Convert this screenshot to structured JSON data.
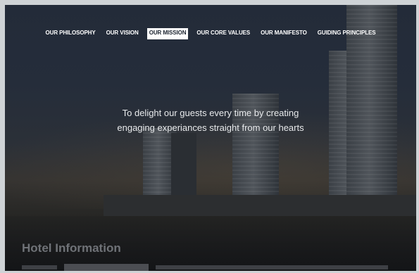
{
  "nav": {
    "items": [
      {
        "label": "OUR PHILOSOPHY"
      },
      {
        "label": "OUR VISION"
      },
      {
        "label": "OUR MISSION"
      },
      {
        "label": "OUR CORE VALUES"
      },
      {
        "label": "OUR MANIFESTO"
      },
      {
        "label": "GUIDING PRINCIPLES"
      }
    ],
    "active": "OUR MISSION"
  },
  "mission": {
    "line1": "To delight our guests every time by creating",
    "line2": "engaging experiances  straight from our hearts"
  },
  "section": {
    "title": "Hotel Information"
  },
  "colors": {
    "nav_active_bg": "#ffffff",
    "nav_text": "#ffffff",
    "mission_text": "#e8eaec",
    "background_dark": "#1f2733"
  }
}
